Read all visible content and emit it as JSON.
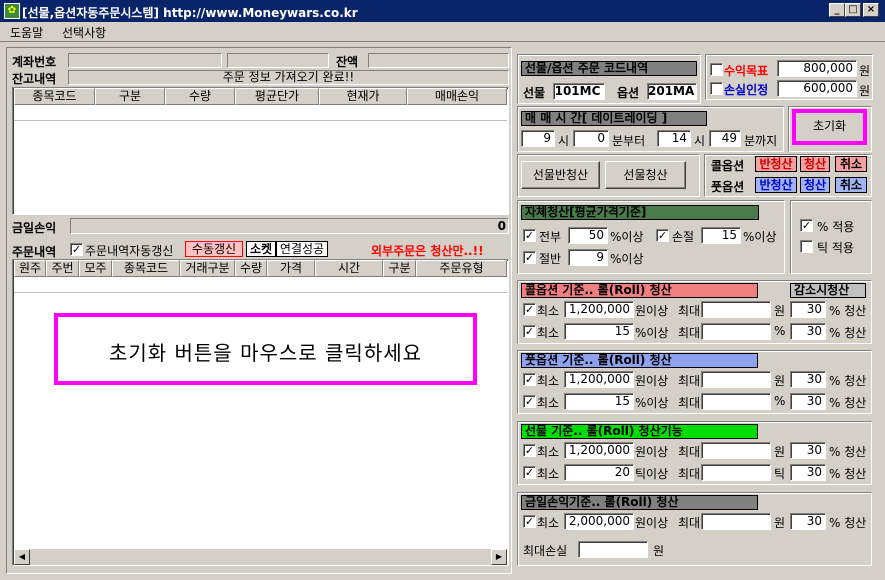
{
  "window": {
    "title": "[선물,옵션자동주문시스템] http://www.Moneywars.co.kr",
    "minimize": "_",
    "maximize": "□",
    "close": "×"
  },
  "menu": {
    "help": "도움말",
    "options": "선택사항"
  },
  "account": {
    "account_label": "계좌번호",
    "balance_label": "잔액"
  },
  "holdings": {
    "label": "잔고내역",
    "status": "주문 정보 가져오기 완료!!",
    "columns": [
      "종목코드",
      "구분",
      "수량",
      "평균단가",
      "현재가",
      "매매손익"
    ]
  },
  "today_pnl": {
    "label": "금일손익",
    "value": "0"
  },
  "orders": {
    "label": "주문내역",
    "auto_refresh_label": "주문내역자동갱신",
    "manual_refresh": "수동갱신",
    "socket": "소켓",
    "connection": "연결성공",
    "notice": "외부주문은 청산만..!!",
    "columns": [
      "원주",
      "주번",
      "모주",
      "종목코드",
      "거래구분",
      "수량",
      "가격",
      "시간",
      "구분",
      "주문유형"
    ]
  },
  "callout": {
    "text": "초기화 버튼을 마우스로 클릭하세요"
  },
  "codes": {
    "title": "선물/옵션 주문 코드내역",
    "futures_label": "선물",
    "futures_code": "101MC",
    "option_label": "옵션",
    "option_code": "201MA"
  },
  "targets": {
    "profit_label": "수익목표",
    "profit_value": "800,000",
    "loss_label": "손실인정",
    "loss_value": "600,000",
    "unit": "원"
  },
  "trade_time": {
    "title": "매 매 시 간[ 데이트레이딩 ]",
    "from_hour": "9",
    "from_min": "0",
    "to_hour": "14",
    "to_min": "49",
    "hour_unit": "시",
    "from_suffix": "분부터",
    "to_suffix": "분까지"
  },
  "reset_button": "초기화",
  "buttons": {
    "futures_half": "선물반청산",
    "futures_close": "선물청산"
  },
  "option_actions": {
    "call_label": "콜옵션",
    "put_label": "풋옵션",
    "half": "반청산",
    "close": "청산",
    "cancel": "취소"
  },
  "auto_close": {
    "title": "자체청산[평균가격기준]",
    "all_label": "전부",
    "all_value": "50",
    "pct_above": "%이상",
    "stop_label": "손절",
    "stop_value": "15",
    "stop_suffix": "%이상",
    "half_label": "절반",
    "half_value": "9",
    "half_suffix": "%이상",
    "pct_apply": "% 적용",
    "tick_apply": "틱 적용"
  },
  "call_roll": {
    "title": "콜옵션 기준.. 롤(Roll) 청산",
    "decrease_label": "감소시청산",
    "min": "최소",
    "max": "최대",
    "r1_value": "1,200,000",
    "r1_unit": "원이상",
    "r1_max_unit": "원",
    "r1_pct": "30",
    "r2_value": "15",
    "r2_unit": "%이상",
    "r2_max_unit": "%",
    "r2_pct": "30",
    "close_suffix": "% 청산"
  },
  "put_roll": {
    "title": "풋옵션 기준.. 롤(Roll) 청산",
    "min": "최소",
    "max": "최대",
    "r1_value": "1,200,000",
    "r1_unit": "원이상",
    "r1_max_unit": "원",
    "r1_pct": "30",
    "r2_value": "15",
    "r2_unit": "%이상",
    "r2_max_unit": "%",
    "r2_pct": "30",
    "close_suffix": "% 청산"
  },
  "fut_roll": {
    "title": "선물 기준.. 롤(Roll) 청산기능",
    "min": "최소",
    "max": "최대",
    "r1_value": "1,200,000",
    "r1_unit": "원이상",
    "r1_max_unit": "원",
    "r1_pct": "30",
    "r2_value": "20",
    "r2_unit": "틱이상",
    "r2_max_unit": "틱",
    "r2_pct": "30",
    "close_suffix": "% 청산"
  },
  "pnl_roll": {
    "title": "금일손익기준.. 롤(Roll) 청산",
    "min": "최소",
    "max": "최대",
    "r1_value": "2,000,000",
    "r1_unit": "원이상",
    "r1_max_unit": "원",
    "r1_pct": "30",
    "close_suffix": "% 청산",
    "max_loss_label": "최대손실",
    "max_loss_unit": "원"
  },
  "colors": {
    "title_bg": "#0a246a",
    "callout": "#ff00ff",
    "red_text": "#ff0000",
    "blue_text": "#0000cc",
    "call_head": "#f08080",
    "put_head": "#8ea2f0",
    "fut_head": "#00dd00",
    "gray_head": "#808080",
    "green_head": "#4a7a4a"
  }
}
